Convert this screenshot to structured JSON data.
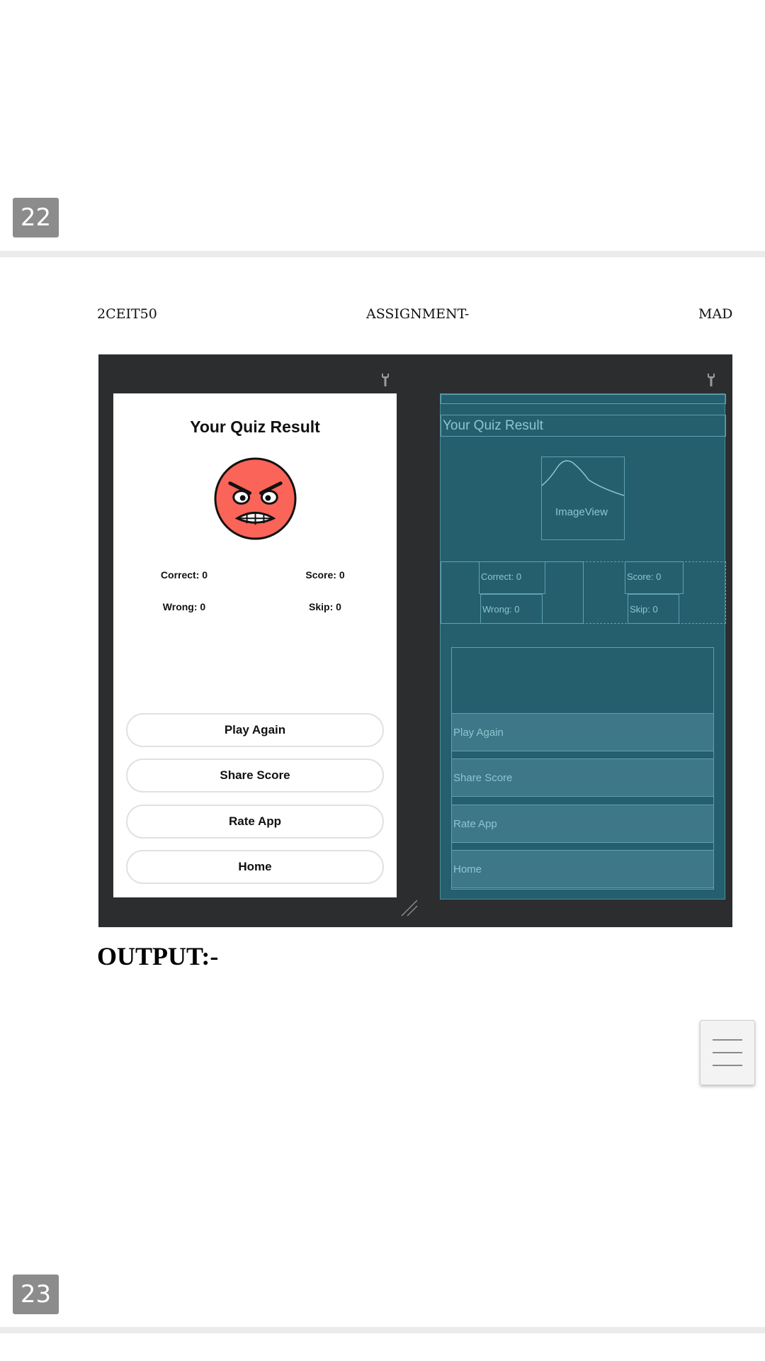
{
  "page_numbers": {
    "top": "22",
    "bottom": "23"
  },
  "doc_header": {
    "left": "2CEIT50",
    "center": "ASSIGNMENT-",
    "right": "MAD"
  },
  "preview": {
    "title": "Your Quiz Result",
    "emoji_icon": "angry-face-icon",
    "stats": {
      "correct": "Correct: 0",
      "score": "Score: 0",
      "wrong": "Wrong: 0",
      "skip": "Skip: 0"
    },
    "buttons": [
      "Play Again",
      "Share Score",
      "Rate App",
      "Home"
    ]
  },
  "blueprint": {
    "title": "Your Quiz Result",
    "image_view": "ImageView",
    "stats": {
      "correct": "Correct: 0",
      "score": "Score: 0",
      "wrong": "Wrong: 0",
      "skip": "Skip: 0"
    },
    "buttons": [
      "Play Again",
      "Share Score",
      "Rate App",
      "Home"
    ]
  },
  "output_label": "OUTPUT:-",
  "colors": {
    "emoji_face": "#fb6458",
    "blueprint_bg": "#255e6d",
    "editor_bg": "#2c2d2f"
  }
}
